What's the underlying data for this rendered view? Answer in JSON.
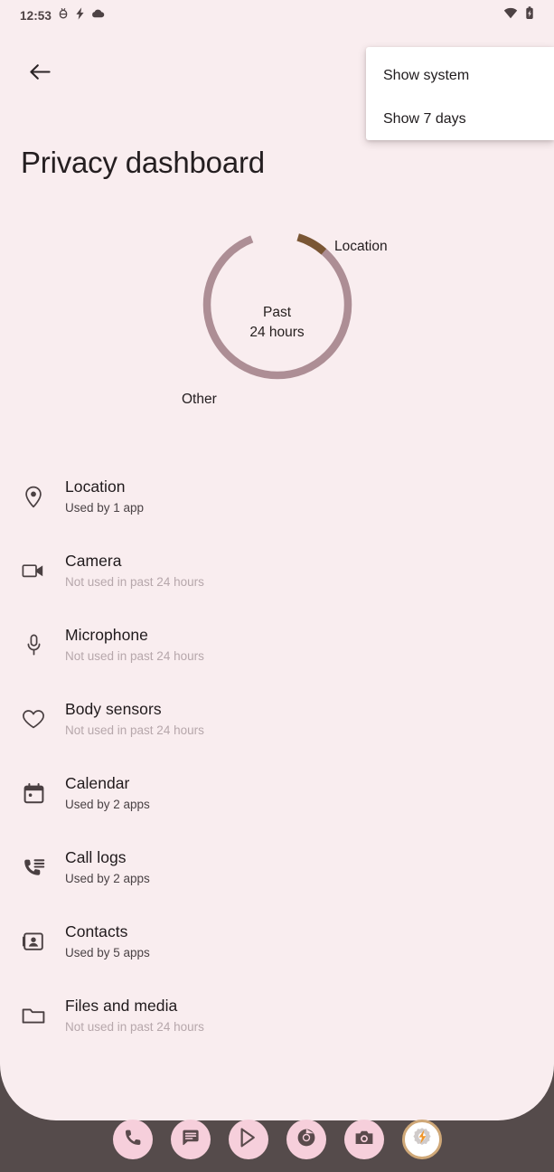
{
  "status_bar": {
    "time": "12:53",
    "left_icons": [
      "bug-icon",
      "lightning-bolt-icon",
      "cloud-icon"
    ],
    "right_icons": [
      "wifi-icon",
      "battery-charging-icon"
    ]
  },
  "app_bar": {
    "back_label": "Back",
    "back_icon": "arrow-left-icon"
  },
  "page": {
    "title": "Privacy dashboard",
    "background_color": "#f9edef",
    "system_background_color": "#554b4b"
  },
  "overflow_menu": {
    "visible": true,
    "items": [
      {
        "label": "Show system"
      },
      {
        "label": "Show 7 days"
      }
    ]
  },
  "chart_data": {
    "type": "pie",
    "title": "",
    "center_line1": "Past",
    "center_line2": "24 hours",
    "categories": [
      "Location",
      "Other"
    ],
    "values": [
      7,
      93
    ],
    "labels": [
      "Location",
      "Other"
    ],
    "colors": [
      "#7a5634",
      "#ad8e95"
    ],
    "legend": "inline-labels",
    "donut": true,
    "unit": "percent"
  },
  "permissions": {
    "items": [
      {
        "icon": "location-pin-icon",
        "title": "Location",
        "subtitle": "Used by 1 app",
        "used": true
      },
      {
        "icon": "camera-icon",
        "title": "Camera",
        "subtitle": "Not used in past 24 hours",
        "used": false
      },
      {
        "icon": "microphone-icon",
        "title": "Microphone",
        "subtitle": "Not used in past 24 hours",
        "used": false
      },
      {
        "icon": "heart-icon",
        "title": "Body sensors",
        "subtitle": "Not used in past 24 hours",
        "used": false
      },
      {
        "icon": "calendar-icon",
        "title": "Calendar",
        "subtitle": "Used by 2 apps",
        "used": true
      },
      {
        "icon": "call-logs-icon",
        "title": "Call logs",
        "subtitle": "Used by 2 apps",
        "used": true
      },
      {
        "icon": "contacts-icon",
        "title": "Contacts",
        "subtitle": "Used by 5 apps",
        "used": true
      },
      {
        "icon": "folder-icon",
        "title": "Files and media",
        "subtitle": "Not used in past 24 hours",
        "used": false
      }
    ]
  },
  "dock": {
    "background_color": "#554b4b",
    "items": [
      {
        "name": "phone-app",
        "label": "Phone"
      },
      {
        "name": "messages-app",
        "label": "Messages"
      },
      {
        "name": "play-store-app",
        "label": "Play Store"
      },
      {
        "name": "chrome-app",
        "label": "Chrome"
      },
      {
        "name": "camera-app",
        "label": "Camera"
      },
      {
        "name": "settings-app",
        "label": "Settings",
        "highlighted": true
      }
    ]
  }
}
